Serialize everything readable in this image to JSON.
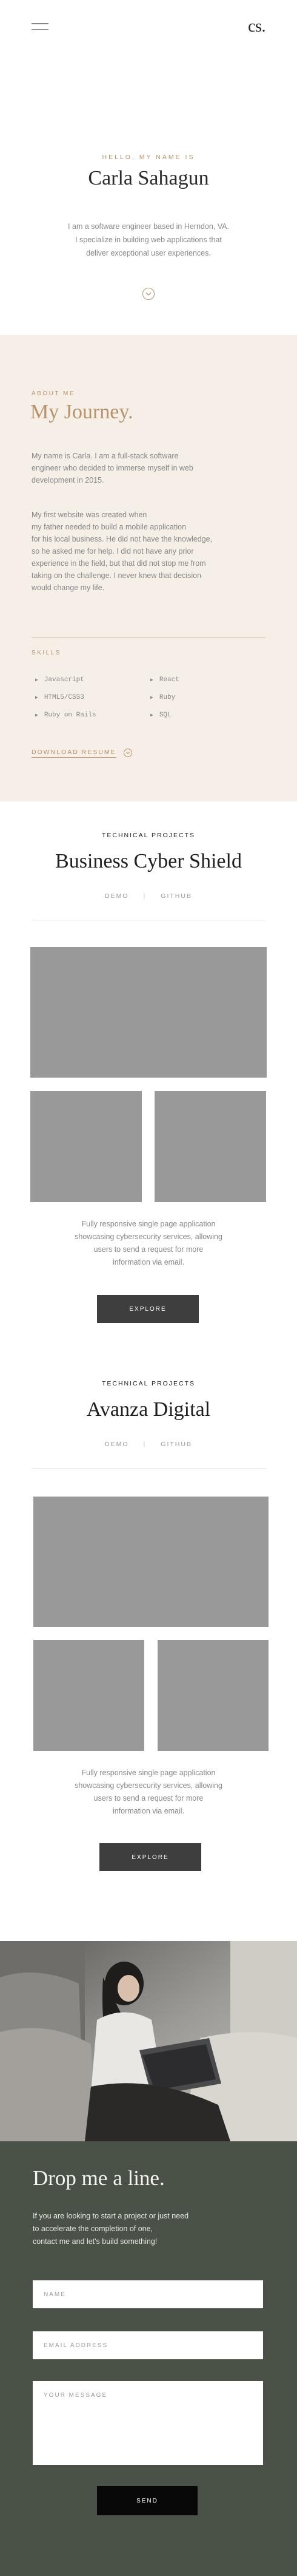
{
  "header": {
    "logo": "cs.",
    "menu_icon": "hamburger-icon"
  },
  "hero": {
    "greeting": "HELLO, MY NAME IS",
    "name": "Carla Sahagun",
    "description_lines": [
      "I am a software engineer based in Herndon, VA.",
      "I specialize in building web applications that",
      "deliver exceptional user experiences."
    ],
    "scroll_icon": "chevron-down-icon",
    "accent_color": "#b8926a"
  },
  "about": {
    "label": "ABOUT ME",
    "title": "My Journey.",
    "paragraph1_lines": [
      "My name is Carla. I am a full-stack software",
      "engineer who decided to immerse myself in web",
      "development in 2015."
    ],
    "paragraph2_lines": [
      "My first website was created when",
      "my father needed to build a mobile application",
      "for his local business. He did not have the knowledge,",
      "so he asked me for help. I did not have any prior",
      "experience in the field, but that did not stop me from",
      "taking on the challenge. I never knew that decision",
      "would change my life."
    ],
    "skills_label": "SKILLS",
    "skills_left": [
      "Javascript",
      "HTML5/CSS3",
      "Ruby on Rails"
    ],
    "skills_right": [
      "React",
      "Ruby",
      "SQL"
    ],
    "resume_label": "DOWNLOAD RESUME",
    "resume_icon": "download-icon",
    "background_color": "#f5efe8"
  },
  "projects": [
    {
      "kicker": "TECHNICAL PROJECTS",
      "title": "Business Cyber Shield",
      "demo_label": "DEMO",
      "separator": "|",
      "github_label": "GITHUB",
      "description_lines": [
        "Fully responsive single page application",
        "showcasing cybersecurity services, allowing",
        "users to send a request  for more",
        "information via email."
      ],
      "button_label": "EXPLORE"
    },
    {
      "kicker": "TECHNICAL PROJECTS",
      "title": "Avanza Digital",
      "demo_label": "DEMO",
      "separator": "|",
      "github_label": "GITHUB",
      "description_lines": [
        "Fully responsive single page application",
        "showcasing cybersecurity services, allowing",
        "users to send a request  for more",
        "information via email."
      ],
      "button_label": "EXPLORE"
    }
  ],
  "contact": {
    "title": "Drop me a line.",
    "description_lines": [
      "If you are looking to start a project or just need",
      "to accelerate the completion of one,",
      "contact me and let's build something!"
    ],
    "name_placeholder": "NAME",
    "email_placeholder": "EMAIL ADDRESS",
    "message_placeholder": "YOUR MESSAGE",
    "send_label": "SEND",
    "background_color": "#4a5248"
  }
}
